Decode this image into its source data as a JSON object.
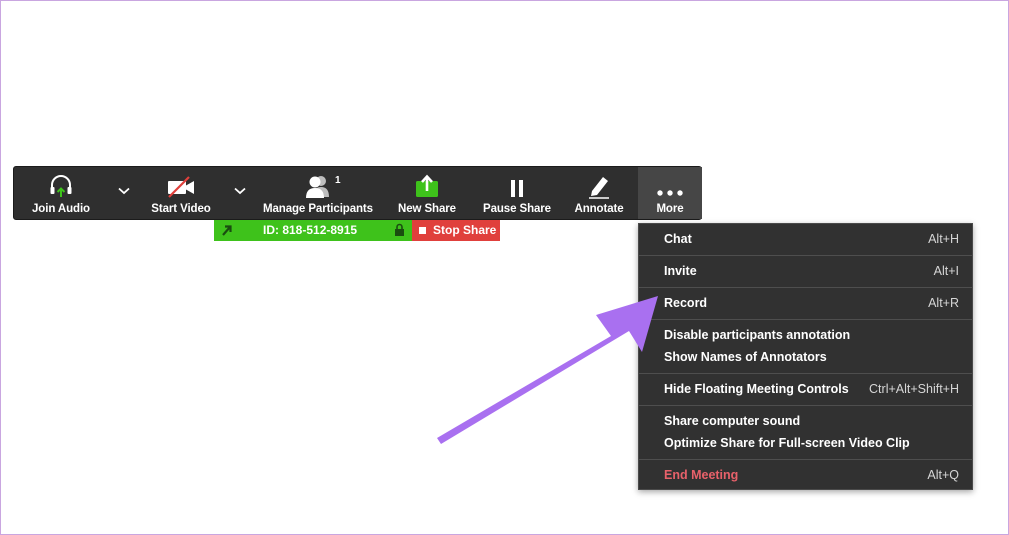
{
  "toolbar": {
    "join_audio": "Join Audio",
    "start_video": "Start Video",
    "manage_participants": "Manage Participants",
    "participant_count": "1",
    "new_share": "New Share",
    "pause_share": "Pause Share",
    "annotate": "Annotate",
    "more": "More"
  },
  "share_bar": {
    "meeting_id": "ID: 818-512-8915",
    "stop_share": "Stop Share"
  },
  "more_menu": {
    "items": [
      {
        "label": "Chat",
        "shortcut": "Alt+H"
      },
      {
        "label": "Invite",
        "shortcut": "Alt+I"
      },
      {
        "label": "Record",
        "shortcut": "Alt+R"
      },
      {
        "label": "Disable participants annotation",
        "shortcut": ""
      },
      {
        "label": "Show Names of Annotators",
        "shortcut": ""
      },
      {
        "label": "Hide Floating Meeting Controls",
        "shortcut": "Ctrl+Alt+Shift+H"
      },
      {
        "label": "Share computer sound",
        "shortcut": ""
      },
      {
        "label": "Optimize Share for Full-screen Video Clip",
        "shortcut": ""
      },
      {
        "label": "End Meeting",
        "shortcut": "Alt+Q"
      }
    ]
  },
  "colors": {
    "toolbar_bg": "#2f2f2f",
    "share_green": "#3ec21b",
    "stop_red": "#e0403c",
    "end_meeting_text": "#e8616a",
    "annotation_arrow": "#a970f0"
  }
}
